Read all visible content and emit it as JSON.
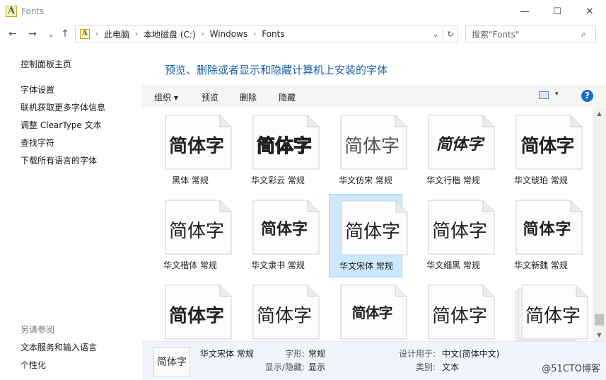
{
  "window": {
    "title": "Fonts",
    "min": "—",
    "max": "☐",
    "close": "✕"
  },
  "nav": {
    "back": "←",
    "forward": "→",
    "recent": "⌄",
    "up": "↑"
  },
  "address": {
    "crumbs": [
      "此电脑",
      "本地磁盘 (C:)",
      "Windows",
      "Fonts"
    ],
    "dropdown": "⌄",
    "refresh": "↻"
  },
  "search": {
    "placeholder": "搜索\"Fonts\"",
    "icon": "search-icon"
  },
  "sidebar": {
    "home": "控制面板主页",
    "links": [
      "字体设置",
      "联机获取更多字体信息",
      "调整 ClearType 文本",
      "查找字符",
      "下载所有语言的字体"
    ],
    "see_also_head": "另请参阅",
    "see_also": [
      "文本服务和输入语言",
      "个性化"
    ]
  },
  "heading": "预览、删除或者显示和隐藏计算机上安装的字体",
  "toolbar": {
    "organize": "组织 ▾",
    "preview": "预览",
    "delete": "删除",
    "hide": "隐藏",
    "view_caret": "▾",
    "help": "?"
  },
  "fonts": [
    {
      "preview": "简体字",
      "name": "黑体 常规"
    },
    {
      "preview": "简体字",
      "name": "华文彩云 常规"
    },
    {
      "preview": "简体字",
      "name": "华文仿宋 常规"
    },
    {
      "preview": "简体字",
      "name": "华文行楷 常规"
    },
    {
      "preview": "简体字",
      "name": "华文琥珀 常规"
    },
    {
      "preview": "简体字",
      "name": "华文楷体 常规"
    },
    {
      "preview": "简体字",
      "name": "华文隶书 常规"
    },
    {
      "preview": "简体字",
      "name": "华文宋体 常规"
    },
    {
      "preview": "简体字",
      "name": "华文细黑 常规"
    },
    {
      "preview": "简体字",
      "name": "华文新魏 常规"
    },
    {
      "preview": "简体字",
      "name": ""
    },
    {
      "preview": "简体字",
      "name": ""
    },
    {
      "preview": "简体字",
      "name": ""
    },
    {
      "preview": "简体字",
      "name": ""
    },
    {
      "preview": "简体字",
      "name": ""
    }
  ],
  "selected_index": 7,
  "details": {
    "thumb": "简体字",
    "name": "华文宋体 常规",
    "style_label": "字形:",
    "style_value": "常规",
    "visibility_label": "显示/隐藏:",
    "visibility_value": "显示",
    "designed_label": "设计用于:",
    "designed_value": "中文(简体中文)",
    "category_label": "类别:",
    "category_value": "文本"
  },
  "watermark": "@51CTO博客",
  "scroll": {
    "up": "▲",
    "down": "▼"
  }
}
